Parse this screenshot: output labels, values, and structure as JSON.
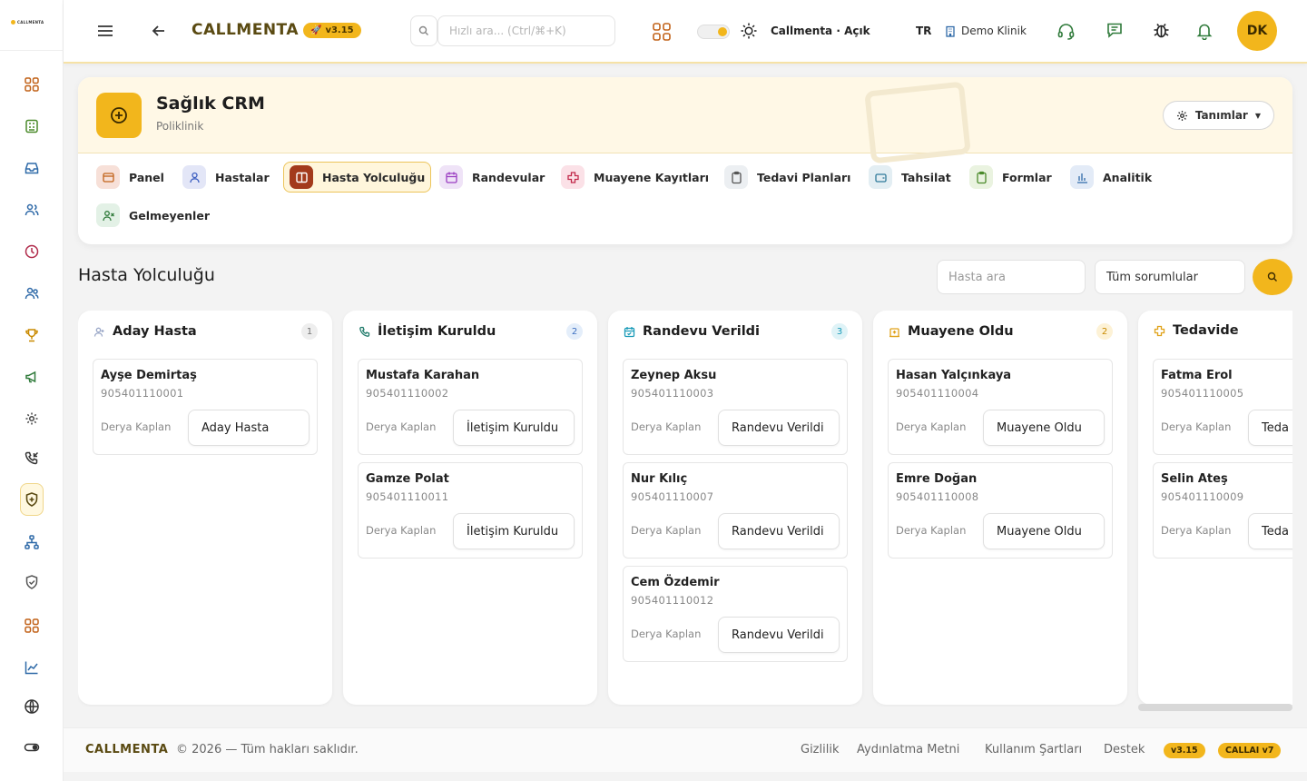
{
  "sidebar": {
    "logo_text": "CALLMENTA",
    "icons": [
      "dashboard-icon",
      "calculator-icon",
      "inbox-icon",
      "users-icon",
      "clock-icon",
      "contacts-icon",
      "trophy-icon",
      "megaphone-icon",
      "settings-gear-icon",
      "phone-incoming-icon",
      "health-shield-icon",
      "org-chart-icon",
      "shield-check-icon",
      "grid-icon",
      "chart-line-icon",
      "globe-icon",
      "toggle-icon"
    ]
  },
  "topbar": {
    "brand": "CALLMENTA",
    "version": "v3.15",
    "search_placeholder": "Hızlı ara... (Ctrl/⌘+K)",
    "theme_label": "Callmenta · Açık",
    "language": "TR",
    "clinic": "Demo Klinik",
    "avatar_initials": "DK"
  },
  "header": {
    "title": "Sağlık CRM",
    "subtitle": "Poliklinik",
    "definitions_button": "Tanımlar"
  },
  "tabs": [
    {
      "label": "Panel",
      "icon": "panel-icon",
      "color": "#f7e0d8"
    },
    {
      "label": "Hastalar",
      "icon": "user-icon",
      "color": "#e3e6f7"
    },
    {
      "label": "Hasta Yolculuğu",
      "icon": "columns-icon",
      "color": "#a33a1c",
      "active": true
    },
    {
      "label": "Randevular",
      "icon": "calendar-icon",
      "color": "#efe3f7"
    },
    {
      "label": "Muayene Kayıtları",
      "icon": "medical-cross-icon",
      "color": "#fbe1e7"
    },
    {
      "label": "Tedavi Planları",
      "icon": "clipboard-icon",
      "color": "#eceff2"
    },
    {
      "label": "Tahsilat",
      "icon": "wallet-icon",
      "color": "#e3eef3"
    },
    {
      "label": "Formlar",
      "icon": "form-clipboard-icon",
      "color": "#eaf3e0"
    },
    {
      "label": "Analitik",
      "icon": "bar-chart-icon",
      "color": "#e3ebf7"
    },
    {
      "label": "Gelmeyenler",
      "icon": "user-x-icon",
      "color": "#e3f1e6"
    }
  ],
  "section": {
    "title": "Hasta Yolculuğu",
    "search_placeholder": "Hasta ara",
    "responsible_filter": "Tüm sorumlular"
  },
  "columns": [
    {
      "title": "Aday Hasta",
      "count": "1",
      "icon": "user-plus-icon",
      "accent": "#9aa7c7",
      "badge_bg": "#eeeeee",
      "badge_fg": "#777777",
      "cards": [
        {
          "name": "Ayşe Demirtaş",
          "phone": "905401110001",
          "owner": "Derya Kaplan",
          "stage": "Aday Hasta"
        }
      ]
    },
    {
      "title": "İletişim Kuruldu",
      "count": "2",
      "icon": "phone-icon",
      "accent": "#1f7a6a",
      "badge_bg": "#e4eefa",
      "badge_fg": "#3d6fc1",
      "cards": [
        {
          "name": "Mustafa Karahan",
          "phone": "905401110002",
          "owner": "Derya Kaplan",
          "stage": "İletişim Kuruldu"
        },
        {
          "name": "Gamze Polat",
          "phone": "905401110011",
          "owner": "Derya Kaplan",
          "stage": "İletişim Kuruldu"
        }
      ]
    },
    {
      "title": "Randevu Verildi",
      "count": "3",
      "icon": "calendar-check-icon",
      "accent": "#1a9bb8",
      "badge_bg": "#dff3f7",
      "badge_fg": "#1a9bb8",
      "cards": [
        {
          "name": "Zeynep Aksu",
          "phone": "905401110003",
          "owner": "Derya Kaplan",
          "stage": "Randevu Verildi"
        },
        {
          "name": "Nur Kılıç",
          "phone": "905401110007",
          "owner": "Derya Kaplan",
          "stage": "Randevu Verildi"
        },
        {
          "name": "Cem Özdemir",
          "phone": "905401110012",
          "owner": "Derya Kaplan",
          "stage": "Randevu Verildi"
        }
      ]
    },
    {
      "title": "Muayene Oldu",
      "count": "2",
      "icon": "hospital-icon",
      "accent": "#e0a21a",
      "badge_bg": "#fdf2d6",
      "badge_fg": "#c98a00",
      "cards": [
        {
          "name": "Hasan Yalçınkaya",
          "phone": "905401110004",
          "owner": "Derya Kaplan",
          "stage": "Muayene Oldu"
        },
        {
          "name": "Emre Doğan",
          "phone": "905401110008",
          "owner": "Derya Kaplan",
          "stage": "Muayene Oldu"
        }
      ]
    },
    {
      "title": "Tedavide",
      "count": "",
      "icon": "plus-cross-icon",
      "accent": "#e0a21a",
      "badge_bg": "#fdf2d6",
      "badge_fg": "#c98a00",
      "cards": [
        {
          "name": "Fatma Erol",
          "phone": "905401110005",
          "owner": "Derya Kaplan",
          "stage": "Teda"
        },
        {
          "name": "Selin Ateş",
          "phone": "905401110009",
          "owner": "Derya Kaplan",
          "stage": "Teda"
        }
      ]
    }
  ],
  "footer": {
    "brand": "CALLMENTA",
    "copyright": "© 2026 — Tüm hakları saklıdır.",
    "links": [
      "Gizlilik",
      "Aydınlatma Metni",
      "Kullanım Şartları",
      "Destek"
    ],
    "version": "v3.15",
    "ai_badge": "CALLAI v7"
  },
  "colors": {
    "accent": "#f2b61c",
    "brand_text": "#5a4a12"
  }
}
